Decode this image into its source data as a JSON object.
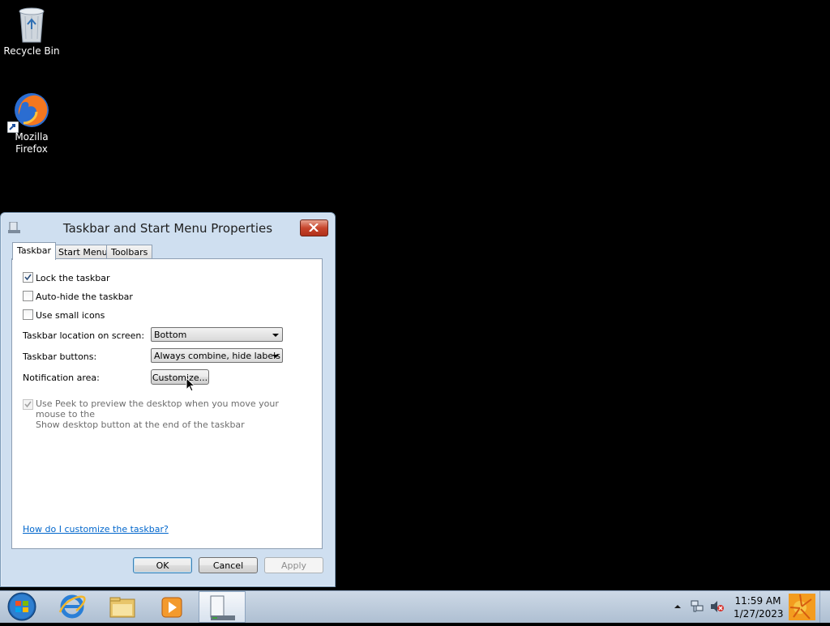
{
  "desktop": {
    "icons": [
      {
        "label": "Recycle Bin"
      },
      {
        "label_line1": "Mozilla",
        "label_line2": "Firefox"
      }
    ]
  },
  "dialog": {
    "title": "Taskbar and Start Menu Properties",
    "tabs": [
      "Taskbar",
      "Start Menu",
      "Toolbars"
    ],
    "active_tab": "Taskbar",
    "options": {
      "lock_taskbar": {
        "label": "Lock the taskbar",
        "checked": true
      },
      "auto_hide": {
        "label": "Auto-hide the taskbar",
        "checked": false
      },
      "small_icons": {
        "label": "Use small icons",
        "checked": false
      }
    },
    "location": {
      "label": "Taskbar location on screen:",
      "value": "Bottom"
    },
    "buttons_setting": {
      "label": "Taskbar buttons:",
      "value": "Always combine, hide labels"
    },
    "notification": {
      "label": "Notification area:",
      "button": "Customize..."
    },
    "peek": {
      "line1": "Use Peek to preview the desktop when you move your mouse to the",
      "line2": "Show desktop button at the end of the taskbar",
      "checked": true,
      "disabled": true
    },
    "help_link": "How do I customize the taskbar?",
    "ok": "OK",
    "cancel": "Cancel",
    "apply": "Apply"
  },
  "taskbar": {
    "time": "11:59 AM",
    "date": "1/27/2023"
  },
  "colors": {
    "dialog_bg": "#cfdff0",
    "taskbar_bg": "#aebfd2",
    "link": "#0066cc"
  }
}
